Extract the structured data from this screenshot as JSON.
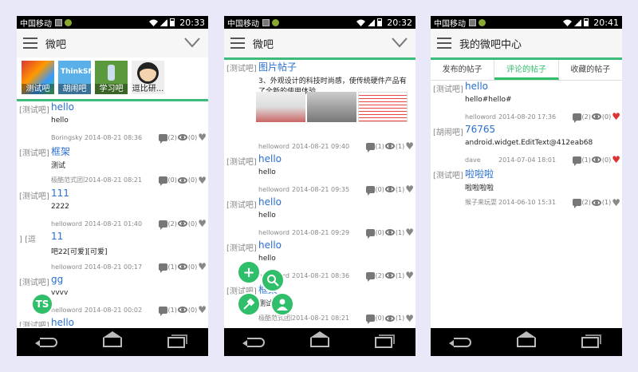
{
  "status": {
    "carrier": "中国移动"
  },
  "screen1": {
    "time": "20:33",
    "title": "微吧",
    "tags": [
      "测试吧",
      "胡闹吧",
      "学习吧",
      "逗比研..."
    ],
    "posts": [
      {
        "cat": "[测试吧]",
        "title": "hello",
        "body": "hello",
        "user": "Boringsky",
        "date": "2014-08-21  08:36",
        "comments": "(2)",
        "views": "(0)",
        "liked": false
      },
      {
        "cat": "[测试吧]",
        "title": "框架",
        "body": "测试",
        "user": "极酷范式团队",
        "date": "2014-08-21  08:21",
        "comments": "(0)",
        "views": "(0)",
        "liked": false
      },
      {
        "cat": "[测试吧]",
        "title": "111",
        "body": "2222",
        "user": "helloword",
        "date": "2014-08-21  01:40",
        "comments": "(2)",
        "views": "(0)",
        "liked": false
      },
      {
        "cat": "] [逗",
        "title": "11",
        "body": "吧22[可爱][可爱]",
        "user": "helloword",
        "date": "2014-08-21  00:17",
        "comments": "(1)",
        "views": "(0)",
        "liked": false
      },
      {
        "cat": "[测试吧]",
        "title": "gg",
        "body": "vvvv",
        "user": "helloword",
        "date": "2014-08-21  00:02",
        "comments": "(1)",
        "views": "(0)",
        "liked": false
      },
      {
        "cat": "[测试吧]",
        "title": "hello",
        "body": "",
        "user": "",
        "date": "",
        "comments": "",
        "views": "",
        "liked": false
      }
    ]
  },
  "screen2": {
    "time": "20:32",
    "title": "微吧",
    "posts": [
      {
        "cat": "[测试吧]",
        "title": "图片帖子",
        "body": "3、外观设计的科技时尚感，使传统硬件产品有了全新的使用体验。",
        "user": "helloword",
        "date": "2014-08-21  09:40",
        "comments": "(1)",
        "views": "(1)",
        "liked": false
      },
      {
        "cat": "[测试吧]",
        "title": "hello",
        "body": "hello",
        "user": "helloword",
        "date": "2014-08-21  09:35",
        "comments": "(0)",
        "views": "(1)",
        "liked": false
      },
      {
        "cat": "[测试吧]",
        "title": "hello",
        "body": "hello",
        "user": "helloword",
        "date": "2014-08-21  09:29",
        "comments": "(0)",
        "views": "(1)",
        "liked": false
      },
      {
        "cat": "[测试吧]",
        "title": "hello",
        "body": "hello",
        "user": "helloword",
        "date": "2014-08-21  08:36",
        "comments": "(2)",
        "views": "(1)",
        "liked": false
      },
      {
        "cat": "[测试吧]",
        "title": "框架",
        "body": "测试",
        "user": "极酷范式团队",
        "date": "2014-08-21  08:21",
        "comments": "(0)",
        "views": "(1)",
        "liked": false
      }
    ]
  },
  "screen3": {
    "time": "20:41",
    "title": "我的微吧中心",
    "tabs": [
      "发布的帖子",
      "评论的帖子",
      "收藏的帖子"
    ],
    "posts": [
      {
        "cat": "[测试吧]",
        "title": "hello",
        "body": "hello#hello#",
        "user": "helloword",
        "date": "2014-08-20  17:36",
        "comments": "(2)",
        "views": "(0)",
        "liked": true
      },
      {
        "cat": "[胡闹吧]",
        "title": "76765",
        "body": "android.widget.EditText@412eab68",
        "user": "dave",
        "date": "2014-07-04  18:01",
        "comments": "(1)",
        "views": "(0)",
        "liked": true
      },
      {
        "cat": "[测试吧]",
        "title": "啦啦啦",
        "body": "啦啦啦啦",
        "user": "猴子来玩耍",
        "date": "2014-06-10  15:31",
        "comments": "(2)",
        "views": "(1)",
        "liked": false
      }
    ]
  },
  "colors": {
    "accent": "#2fbf6a",
    "link": "#2a6fd0",
    "like": "#d33333"
  }
}
